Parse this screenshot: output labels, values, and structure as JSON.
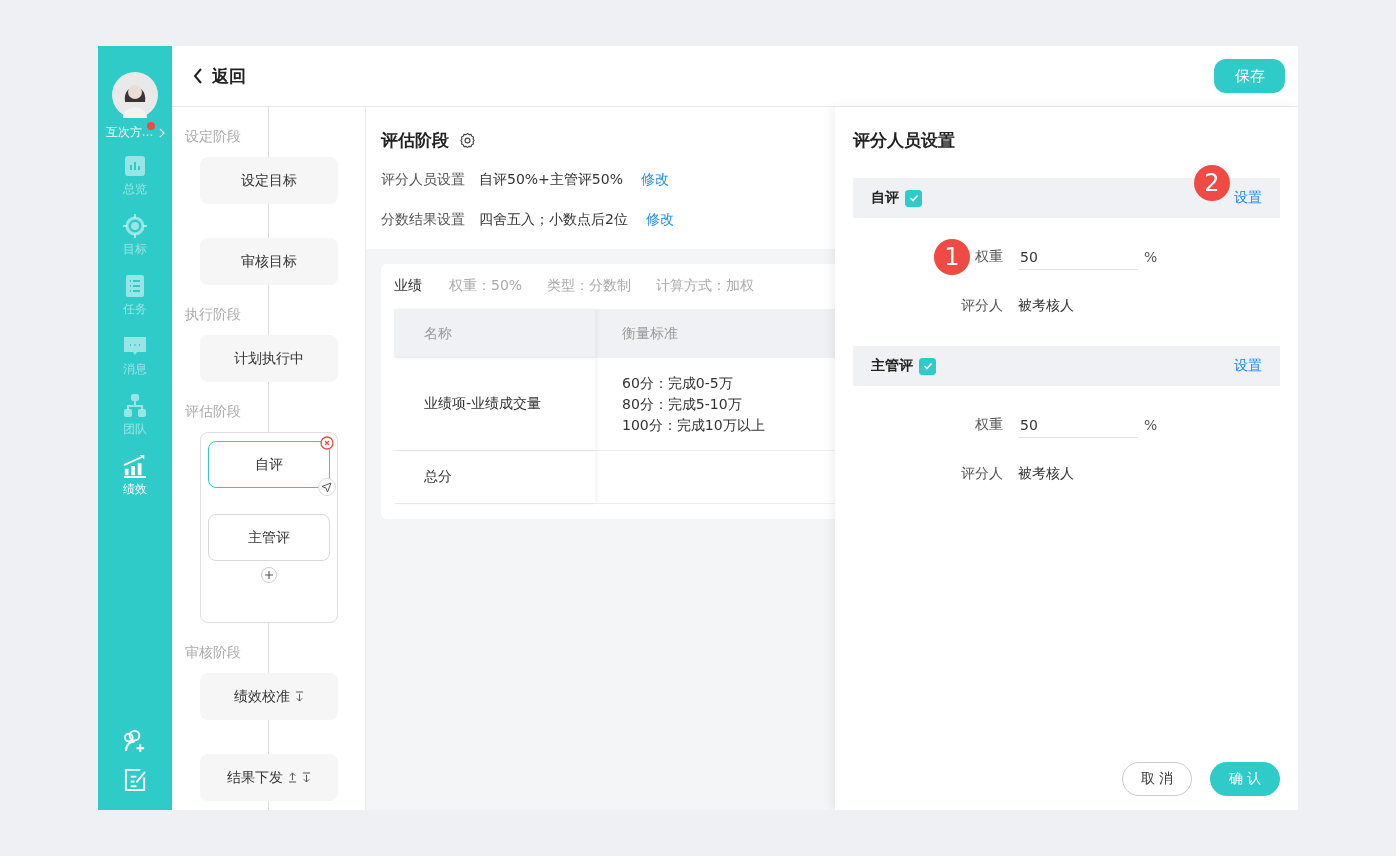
{
  "sidebar": {
    "user_name": "互次方…",
    "has_notification": true,
    "nav": [
      {
        "label": "总览",
        "selected": false
      },
      {
        "label": "目标",
        "selected": false
      },
      {
        "label": "任务",
        "selected": false
      },
      {
        "label": "消息",
        "selected": false
      },
      {
        "label": "团队",
        "selected": false
      },
      {
        "label": "绩效",
        "selected": true
      }
    ]
  },
  "topbar": {
    "back": "返回",
    "save": "保存"
  },
  "flow": [
    {
      "stage": "设定阶段",
      "kind": "plain",
      "nodes": [
        {
          "label": "设定目标",
          "selected": false,
          "move_up": false,
          "move_down": false
        },
        {
          "label": "审核目标",
          "selected": false,
          "move_up": false,
          "move_down": false
        }
      ]
    },
    {
      "stage": "执行阶段",
      "kind": "plain",
      "nodes": [
        {
          "label": "计划执行中",
          "selected": false,
          "move_up": false,
          "move_down": false
        }
      ]
    },
    {
      "stage": "评估阶段",
      "kind": "group",
      "nodes": [
        {
          "label": "自评",
          "selected": true,
          "move_up": false,
          "move_down": false
        },
        {
          "label": "主管评",
          "selected": false,
          "move_up": false,
          "move_down": false
        }
      ]
    },
    {
      "stage": "审核阶段",
      "kind": "plain",
      "nodes": [
        {
          "label": "绩效校准",
          "selected": false,
          "move_up": false,
          "move_down": true
        },
        {
          "label": "结果下发",
          "selected": false,
          "move_up": true,
          "move_down": true
        }
      ]
    }
  ],
  "stage": {
    "title": "评估阶段",
    "settings": [
      {
        "label": "评分人员设置",
        "value": "自评50%+主管评50%",
        "action": "修改"
      },
      {
        "label": "分数结果设置",
        "value": "四舍五入；小数点后2位",
        "action": "修改"
      }
    ]
  },
  "card": {
    "title": "业绩",
    "meta": [
      "权重：50%",
      "类型：分数制",
      "计算方式：加权"
    ],
    "columns": [
      "名称",
      "衡量标准"
    ],
    "rows": [
      {
        "name": "业绩项-业绩成交量",
        "criteria": [
          "60分：完成0-5万",
          "80分：完成5-10万",
          "100分：完成10万以上"
        ]
      },
      {
        "name": "总分"
      }
    ]
  },
  "drawer": {
    "title": "评分人员设置",
    "sections": [
      {
        "name": "自评",
        "checked": true,
        "action": "设置",
        "action_marker": "2",
        "weight_label": "权重",
        "weight_marker": "1",
        "weight": "50",
        "unit": "%",
        "rater_label": "评分人",
        "rater": "被考核人"
      },
      {
        "name": "主管评",
        "checked": true,
        "action": "设置",
        "weight_label": "权重",
        "weight": "50",
        "unit": "%",
        "rater_label": "评分人",
        "rater": "被考核人"
      }
    ],
    "cancel": "取 消",
    "confirm": "确 认"
  }
}
